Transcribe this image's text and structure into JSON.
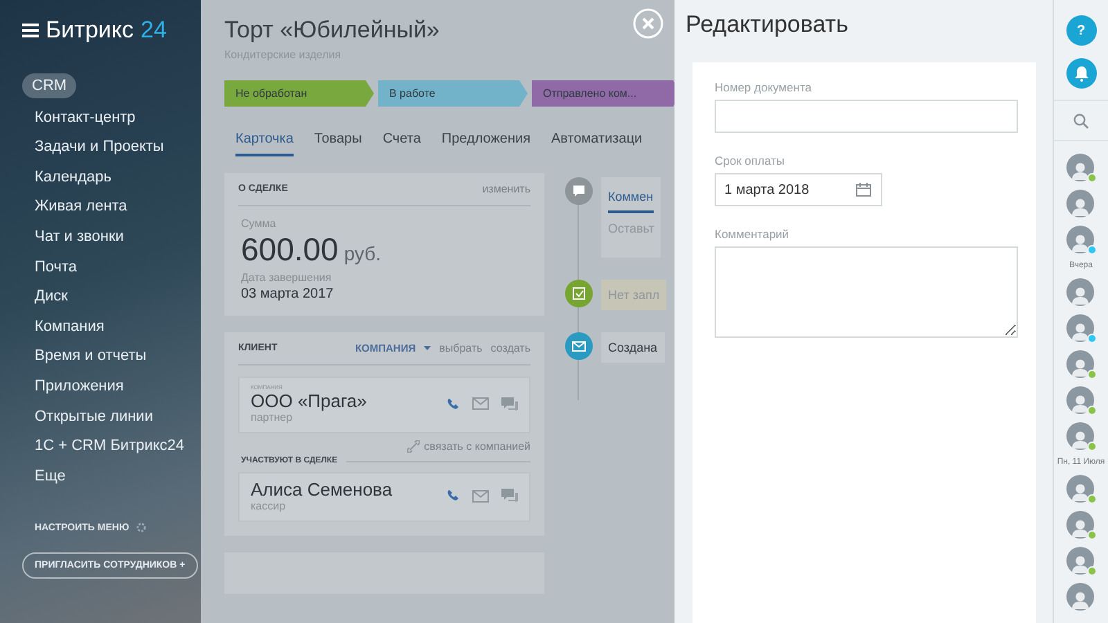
{
  "sidebar": {
    "logo": {
      "name": "Битрикс",
      "suffix": "24"
    },
    "items": [
      {
        "label": "CRM",
        "selected": true
      },
      {
        "label": "Контакт-центр",
        "selected": false
      },
      {
        "label": "Задачи и Проекты",
        "selected": false
      },
      {
        "label": "Календарь",
        "selected": false
      },
      {
        "label": "Живая лента",
        "selected": false
      },
      {
        "label": "Чат и звонки",
        "selected": false
      },
      {
        "label": "Почта",
        "selected": false
      },
      {
        "label": "Диск",
        "selected": false
      },
      {
        "label": "Компания",
        "selected": false
      },
      {
        "label": "Время и отчеты",
        "selected": false
      },
      {
        "label": "Приложения",
        "selected": false
      },
      {
        "label": "Открытые линии",
        "selected": false
      },
      {
        "label": "1С + CRM Битрикс24",
        "selected": false
      },
      {
        "label": "Еще",
        "selected": false
      }
    ],
    "settings": "НАСТРОИТЬ МЕНЮ",
    "invite": "ПРИГЛАСИТЬ СОТРУДНИКОВ +"
  },
  "deal": {
    "title": "Торт «Юбилейный»",
    "subtitle": "Кондитерские изделия",
    "stages": [
      {
        "label": "Не обработан",
        "color": "#78a83e"
      },
      {
        "label": "В работе",
        "color": "#73b3c9"
      },
      {
        "label": "Отправлено ком...",
        "color": "#8f6aa6"
      }
    ],
    "tabs": [
      {
        "label": "Карточка",
        "selected": true
      },
      {
        "label": "Товары",
        "selected": false
      },
      {
        "label": "Счета",
        "selected": false
      },
      {
        "label": "Предложения",
        "selected": false
      },
      {
        "label": "Автоматизаци",
        "selected": false
      }
    ],
    "about": {
      "heading": "О СДЕЛКЕ",
      "edit": "изменить",
      "sum_label": "Сумма",
      "sum": "600.00",
      "currency": "руб.",
      "date_label": "Дата завершения",
      "date": "03 марта 2017"
    },
    "client": {
      "heading": "КЛИЕНТ",
      "type": "КОМПАНИЯ",
      "select": "выбрать",
      "create": "создать",
      "company": {
        "caption": "КОМПАНИЯ",
        "name": "ООО «Прага»",
        "role": "партнер"
      },
      "link": "связать с компанией",
      "participants": "УЧАСТВУЮТ В СДЕЛКЕ",
      "contact": {
        "name": "Алиса Семенова",
        "role": "кассир"
      }
    },
    "timeline": [
      {
        "kind": "comment",
        "tab": "Коммен",
        "text": "Оставьт"
      },
      {
        "kind": "task",
        "text": "Нет запл"
      },
      {
        "kind": "mail",
        "text": "Создана"
      }
    ]
  },
  "editor": {
    "title": "Редактировать",
    "fields": [
      {
        "kind": "text",
        "label": "Номер документа"
      },
      {
        "kind": "date",
        "label": "Срок оплаты",
        "value": "1 марта 2018"
      },
      {
        "kind": "textarea",
        "label": "Комментарий"
      }
    ]
  },
  "rightbar": {
    "help": "?",
    "items": [
      {
        "kind": "avatar",
        "color": "#8bc34a"
      },
      {
        "kind": "avatar"
      },
      {
        "kind": "avatar",
        "color": "#2fc6f6"
      },
      {
        "kind": "date",
        "label": "Вчера"
      },
      {
        "kind": "avatar"
      },
      {
        "kind": "avatar",
        "color": "#2fc6f6"
      },
      {
        "kind": "avatar",
        "color": "#8bc34a"
      },
      {
        "kind": "avatar",
        "color": "#8bc34a"
      },
      {
        "kind": "avatar",
        "color": "#8bc34a"
      },
      {
        "kind": "date",
        "label": "Пн, 11 Июля"
      },
      {
        "kind": "avatar",
        "color": "#8bc34a"
      },
      {
        "kind": "avatar",
        "color": "#8bc34a"
      },
      {
        "kind": "avatar",
        "color": "#8bc34a"
      },
      {
        "kind": "avatar"
      }
    ]
  }
}
